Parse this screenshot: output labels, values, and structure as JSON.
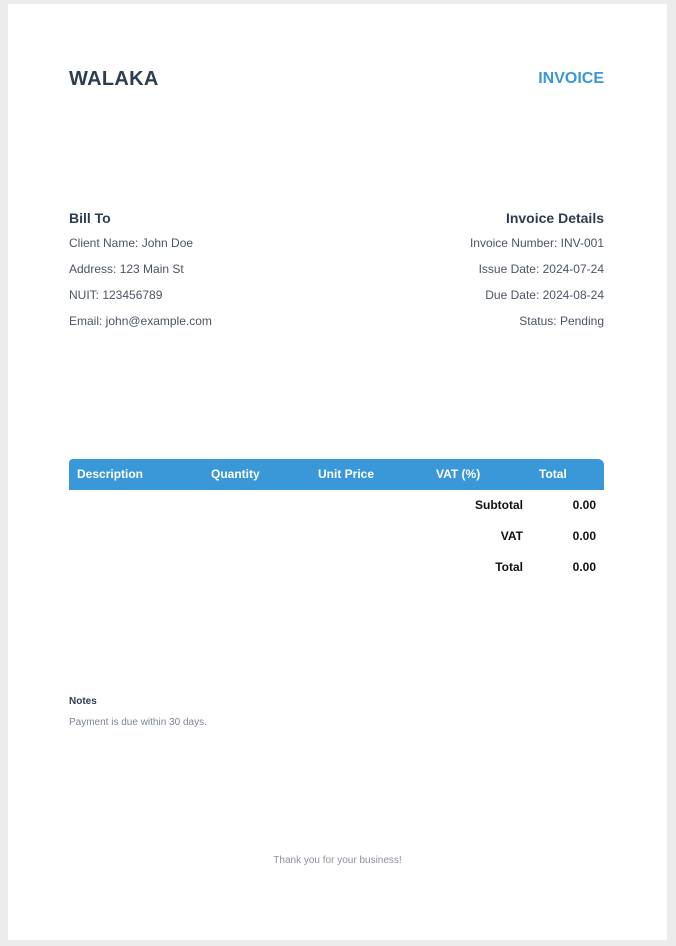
{
  "header": {
    "company": "WALAKA",
    "document_type": "INVOICE"
  },
  "bill_to": {
    "title": "Bill To",
    "client_name": "Client Name: John Doe",
    "address": "Address: 123 Main St",
    "nuit": "NUIT: 123456789",
    "email": "Email: john@example.com"
  },
  "invoice_details": {
    "title": "Invoice Details",
    "number": "Invoice Number: INV-001",
    "issue_date": "Issue Date: 2024-07-24",
    "due_date": "Due Date: 2024-08-24",
    "status": "Status: Pending"
  },
  "table": {
    "columns": [
      "Description",
      "Quantity",
      "Unit Price",
      "VAT (%)",
      "Total"
    ],
    "rows": []
  },
  "totals": {
    "subtotal_label": "Subtotal",
    "subtotal_value": "0.00",
    "vat_label": "VAT",
    "vat_value": "0.00",
    "total_label": "Total",
    "total_value": "0.00"
  },
  "notes": {
    "title": "Notes",
    "text": "Payment is due within 30 days."
  },
  "footer": {
    "text": "Thank you for your business!"
  },
  "colors": {
    "accent": "#3a97d8",
    "heading": "#2c3e50"
  }
}
